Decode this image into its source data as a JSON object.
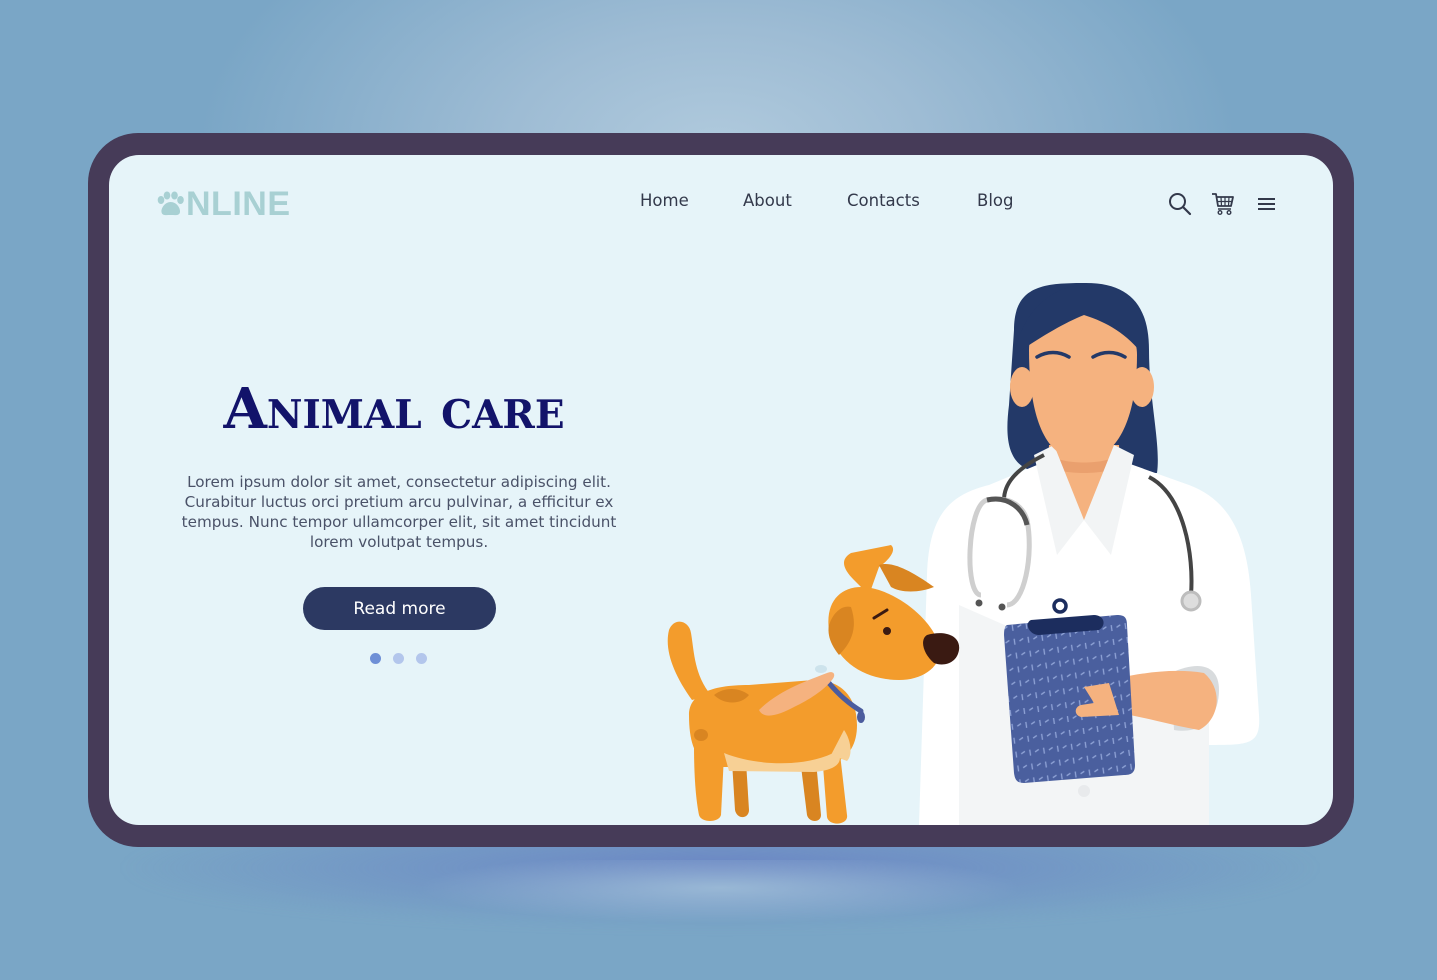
{
  "brand": {
    "logo_text": "NLINE",
    "logo_icon": "paw-icon",
    "logo_color": "#a8d0d3"
  },
  "nav": {
    "items": [
      {
        "label": "Home"
      },
      {
        "label": "About"
      },
      {
        "label": "Contacts"
      },
      {
        "label": "Blog"
      }
    ]
  },
  "header_icons": [
    {
      "name": "search-icon",
      "label": "Search"
    },
    {
      "name": "cart-icon",
      "label": "Cart"
    },
    {
      "name": "menu-icon",
      "label": "Menu"
    }
  ],
  "hero": {
    "title": "Animal care",
    "body": "Lorem ipsum dolor sit amet, consectetur adipiscing elit. Curabitur luctus orci pretium arcu pulvinar, a efficitur ex tempus. Nunc tempor ullamcorper elit, sit amet tincidunt lorem volutpat tempus.",
    "cta_label": "Read more"
  },
  "carousel": {
    "total": 3,
    "active_index": 0,
    "active_color": "#6e8fd6",
    "inactive_color": "#b3c6ec"
  },
  "colors": {
    "device_frame": "#463b58",
    "screen_bg": "#e6f4f9",
    "title": "#12136a",
    "button_bg": "#2c3962",
    "nav_text": "#33394b"
  },
  "illustration": {
    "subject": "veterinarian with stethoscope and clipboard petting a dog"
  }
}
